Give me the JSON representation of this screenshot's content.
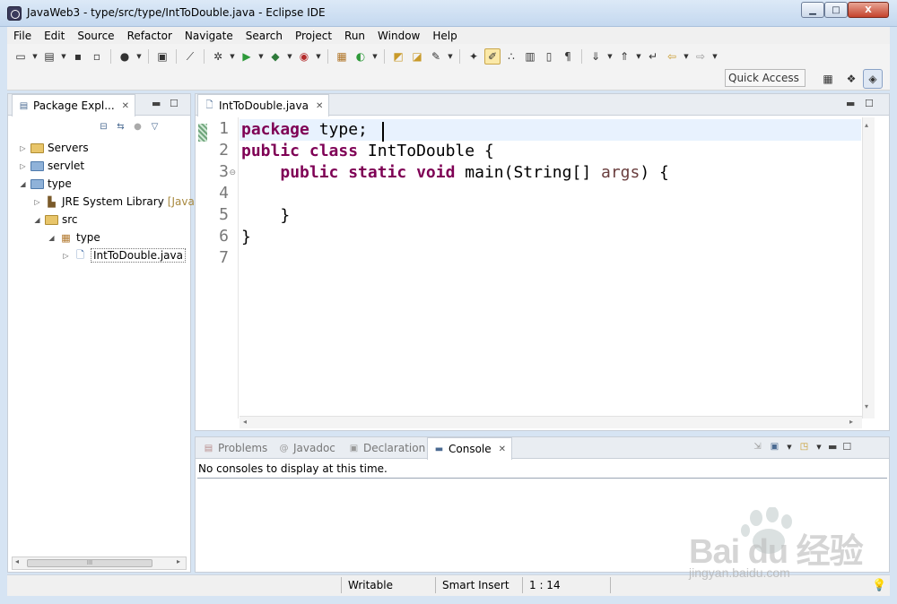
{
  "window": {
    "title": "JavaWeb3 - type/src/type/IntToDouble.java - Eclipse IDE",
    "min_label": "▁",
    "max_label": "□",
    "close_label": "X"
  },
  "menu": [
    "File",
    "Edit",
    "Source",
    "Refactor",
    "Navigate",
    "Search",
    "Project",
    "Run",
    "Window",
    "Help"
  ],
  "toolbar": {
    "quick_access": "Quick Access"
  },
  "package_explorer": {
    "tab_label": "Package Expl...",
    "tree": [
      {
        "label": "Servers",
        "icon": "folder-icon"
      },
      {
        "label": "servlet",
        "icon": "project-icon"
      },
      {
        "label": "type",
        "icon": "project-icon"
      },
      {
        "label": "JRE System Library",
        "decor": "[Java",
        "icon": "library-icon"
      },
      {
        "label": "src",
        "icon": "source-folder-icon"
      },
      {
        "label": "type",
        "icon": "package-icon"
      },
      {
        "label": "IntToDouble.java",
        "icon": "java-file-icon"
      }
    ],
    "scroll_label": "III"
  },
  "editor": {
    "tab_label": "IntToDouble.java",
    "line_numbers": [
      "1",
      "2",
      "3",
      "4",
      "5",
      "6",
      "7"
    ],
    "lines": [
      {
        "kw": "package",
        "rest": " type;"
      },
      {
        "kw": "public class",
        "rest": " IntToDouble {"
      },
      {
        "indent": "    ",
        "kw": "public static void",
        "rest": " main(String[] ",
        "param": "args",
        "tail": ") {"
      },
      {
        "rest": ""
      },
      {
        "rest": "    }"
      },
      {
        "rest": "}"
      },
      {
        "rest": ""
      }
    ]
  },
  "bottom_panel": {
    "tabs": [
      "Problems",
      "Javadoc",
      "Declaration",
      "Console"
    ],
    "active_tab": "Console",
    "message": "No consoles to display at this time."
  },
  "status": {
    "writable": "Writable",
    "insert_mode": "Smart Insert",
    "position": "1 : 14"
  },
  "watermark": {
    "text": "Bai du 经验",
    "sub": "jingyan.baidu.com"
  }
}
